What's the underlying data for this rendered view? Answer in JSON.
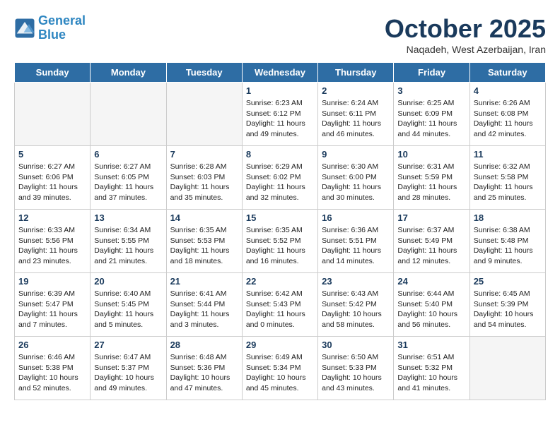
{
  "logo": {
    "line1": "General",
    "line2": "Blue"
  },
  "title": "October 2025",
  "subtitle": "Naqadeh, West Azerbaijan, Iran",
  "days_of_week": [
    "Sunday",
    "Monday",
    "Tuesday",
    "Wednesday",
    "Thursday",
    "Friday",
    "Saturday"
  ],
  "weeks": [
    [
      {
        "day": "",
        "info": ""
      },
      {
        "day": "",
        "info": ""
      },
      {
        "day": "",
        "info": ""
      },
      {
        "day": "1",
        "info": "Sunrise: 6:23 AM\nSunset: 6:12 PM\nDaylight: 11 hours\nand 49 minutes."
      },
      {
        "day": "2",
        "info": "Sunrise: 6:24 AM\nSunset: 6:11 PM\nDaylight: 11 hours\nand 46 minutes."
      },
      {
        "day": "3",
        "info": "Sunrise: 6:25 AM\nSunset: 6:09 PM\nDaylight: 11 hours\nand 44 minutes."
      },
      {
        "day": "4",
        "info": "Sunrise: 6:26 AM\nSunset: 6:08 PM\nDaylight: 11 hours\nand 42 minutes."
      }
    ],
    [
      {
        "day": "5",
        "info": "Sunrise: 6:27 AM\nSunset: 6:06 PM\nDaylight: 11 hours\nand 39 minutes."
      },
      {
        "day": "6",
        "info": "Sunrise: 6:27 AM\nSunset: 6:05 PM\nDaylight: 11 hours\nand 37 minutes."
      },
      {
        "day": "7",
        "info": "Sunrise: 6:28 AM\nSunset: 6:03 PM\nDaylight: 11 hours\nand 35 minutes."
      },
      {
        "day": "8",
        "info": "Sunrise: 6:29 AM\nSunset: 6:02 PM\nDaylight: 11 hours\nand 32 minutes."
      },
      {
        "day": "9",
        "info": "Sunrise: 6:30 AM\nSunset: 6:00 PM\nDaylight: 11 hours\nand 30 minutes."
      },
      {
        "day": "10",
        "info": "Sunrise: 6:31 AM\nSunset: 5:59 PM\nDaylight: 11 hours\nand 28 minutes."
      },
      {
        "day": "11",
        "info": "Sunrise: 6:32 AM\nSunset: 5:58 PM\nDaylight: 11 hours\nand 25 minutes."
      }
    ],
    [
      {
        "day": "12",
        "info": "Sunrise: 6:33 AM\nSunset: 5:56 PM\nDaylight: 11 hours\nand 23 minutes."
      },
      {
        "day": "13",
        "info": "Sunrise: 6:34 AM\nSunset: 5:55 PM\nDaylight: 11 hours\nand 21 minutes."
      },
      {
        "day": "14",
        "info": "Sunrise: 6:35 AM\nSunset: 5:53 PM\nDaylight: 11 hours\nand 18 minutes."
      },
      {
        "day": "15",
        "info": "Sunrise: 6:35 AM\nSunset: 5:52 PM\nDaylight: 11 hours\nand 16 minutes."
      },
      {
        "day": "16",
        "info": "Sunrise: 6:36 AM\nSunset: 5:51 PM\nDaylight: 11 hours\nand 14 minutes."
      },
      {
        "day": "17",
        "info": "Sunrise: 6:37 AM\nSunset: 5:49 PM\nDaylight: 11 hours\nand 12 minutes."
      },
      {
        "day": "18",
        "info": "Sunrise: 6:38 AM\nSunset: 5:48 PM\nDaylight: 11 hours\nand 9 minutes."
      }
    ],
    [
      {
        "day": "19",
        "info": "Sunrise: 6:39 AM\nSunset: 5:47 PM\nDaylight: 11 hours\nand 7 minutes."
      },
      {
        "day": "20",
        "info": "Sunrise: 6:40 AM\nSunset: 5:45 PM\nDaylight: 11 hours\nand 5 minutes."
      },
      {
        "day": "21",
        "info": "Sunrise: 6:41 AM\nSunset: 5:44 PM\nDaylight: 11 hours\nand 3 minutes."
      },
      {
        "day": "22",
        "info": "Sunrise: 6:42 AM\nSunset: 5:43 PM\nDaylight: 11 hours\nand 0 minutes."
      },
      {
        "day": "23",
        "info": "Sunrise: 6:43 AM\nSunset: 5:42 PM\nDaylight: 10 hours\nand 58 minutes."
      },
      {
        "day": "24",
        "info": "Sunrise: 6:44 AM\nSunset: 5:40 PM\nDaylight: 10 hours\nand 56 minutes."
      },
      {
        "day": "25",
        "info": "Sunrise: 6:45 AM\nSunset: 5:39 PM\nDaylight: 10 hours\nand 54 minutes."
      }
    ],
    [
      {
        "day": "26",
        "info": "Sunrise: 6:46 AM\nSunset: 5:38 PM\nDaylight: 10 hours\nand 52 minutes."
      },
      {
        "day": "27",
        "info": "Sunrise: 6:47 AM\nSunset: 5:37 PM\nDaylight: 10 hours\nand 49 minutes."
      },
      {
        "day": "28",
        "info": "Sunrise: 6:48 AM\nSunset: 5:36 PM\nDaylight: 10 hours\nand 47 minutes."
      },
      {
        "day": "29",
        "info": "Sunrise: 6:49 AM\nSunset: 5:34 PM\nDaylight: 10 hours\nand 45 minutes."
      },
      {
        "day": "30",
        "info": "Sunrise: 6:50 AM\nSunset: 5:33 PM\nDaylight: 10 hours\nand 43 minutes."
      },
      {
        "day": "31",
        "info": "Sunrise: 6:51 AM\nSunset: 5:32 PM\nDaylight: 10 hours\nand 41 minutes."
      },
      {
        "day": "",
        "info": ""
      }
    ]
  ]
}
